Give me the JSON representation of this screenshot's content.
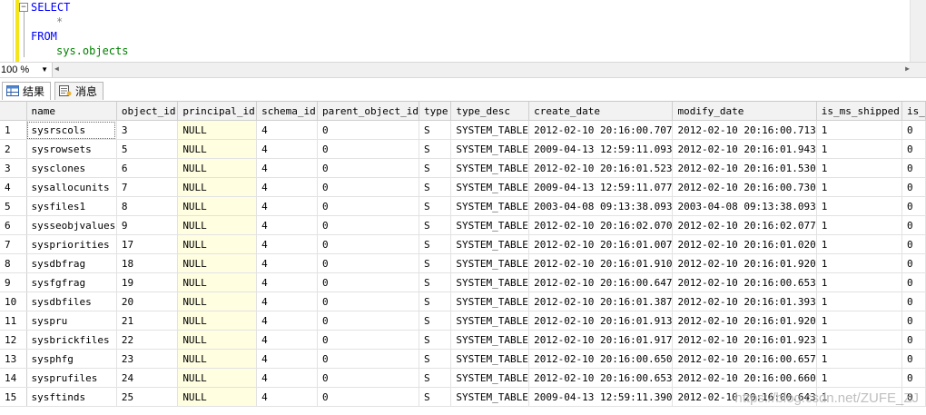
{
  "editor": {
    "lines": [
      "SELECT",
      "*",
      "FROM",
      "sys.objects"
    ],
    "fold_symbol": "−"
  },
  "zoom": {
    "value": "100 %"
  },
  "tabs": [
    {
      "label": "结果",
      "icon": "results-grid-icon"
    },
    {
      "label": "消息",
      "icon": "messages-icon"
    }
  ],
  "grid": {
    "columns": [
      "",
      "name",
      "object_id",
      "principal_id",
      "schema_id",
      "parent_object_id",
      "type",
      "type_desc",
      "create_date",
      "modify_date",
      "is_ms_shipped",
      "is_"
    ],
    "rows": [
      [
        "1",
        "sysrscols",
        "3",
        "NULL",
        "4",
        "0",
        "S",
        "SYSTEM_TABLE",
        "2012-02-10 20:16:00.707",
        "2012-02-10 20:16:00.713",
        "1",
        "0"
      ],
      [
        "2",
        "sysrowsets",
        "5",
        "NULL",
        "4",
        "0",
        "S",
        "SYSTEM_TABLE",
        "2009-04-13 12:59:11.093",
        "2012-02-10 20:16:01.943",
        "1",
        "0"
      ],
      [
        "3",
        "sysclones",
        "6",
        "NULL",
        "4",
        "0",
        "S",
        "SYSTEM_TABLE",
        "2012-02-10 20:16:01.523",
        "2012-02-10 20:16:01.530",
        "1",
        "0"
      ],
      [
        "4",
        "sysallocunits",
        "7",
        "NULL",
        "4",
        "0",
        "S",
        "SYSTEM_TABLE",
        "2009-04-13 12:59:11.077",
        "2012-02-10 20:16:00.730",
        "1",
        "0"
      ],
      [
        "5",
        "sysfiles1",
        "8",
        "NULL",
        "4",
        "0",
        "S",
        "SYSTEM_TABLE",
        "2003-04-08 09:13:38.093",
        "2003-04-08 09:13:38.093",
        "1",
        "0"
      ],
      [
        "6",
        "sysseobjvalues",
        "9",
        "NULL",
        "4",
        "0",
        "S",
        "SYSTEM_TABLE",
        "2012-02-10 20:16:02.070",
        "2012-02-10 20:16:02.077",
        "1",
        "0"
      ],
      [
        "7",
        "syspriorities",
        "17",
        "NULL",
        "4",
        "0",
        "S",
        "SYSTEM_TABLE",
        "2012-02-10 20:16:01.007",
        "2012-02-10 20:16:01.020",
        "1",
        "0"
      ],
      [
        "8",
        "sysdbfrag",
        "18",
        "NULL",
        "4",
        "0",
        "S",
        "SYSTEM_TABLE",
        "2012-02-10 20:16:01.910",
        "2012-02-10 20:16:01.920",
        "1",
        "0"
      ],
      [
        "9",
        "sysfgfrag",
        "19",
        "NULL",
        "4",
        "0",
        "S",
        "SYSTEM_TABLE",
        "2012-02-10 20:16:00.647",
        "2012-02-10 20:16:00.653",
        "1",
        "0"
      ],
      [
        "10",
        "sysdbfiles",
        "20",
        "NULL",
        "4",
        "0",
        "S",
        "SYSTEM_TABLE",
        "2012-02-10 20:16:01.387",
        "2012-02-10 20:16:01.393",
        "1",
        "0"
      ],
      [
        "11",
        "syspru",
        "21",
        "NULL",
        "4",
        "0",
        "S",
        "SYSTEM_TABLE",
        "2012-02-10 20:16:01.913",
        "2012-02-10 20:16:01.920",
        "1",
        "0"
      ],
      [
        "12",
        "sysbrickfiles",
        "22",
        "NULL",
        "4",
        "0",
        "S",
        "SYSTEM_TABLE",
        "2012-02-10 20:16:01.917",
        "2012-02-10 20:16:01.923",
        "1",
        "0"
      ],
      [
        "13",
        "sysphfg",
        "23",
        "NULL",
        "4",
        "0",
        "S",
        "SYSTEM_TABLE",
        "2012-02-10 20:16:00.650",
        "2012-02-10 20:16:00.657",
        "1",
        "0"
      ],
      [
        "14",
        "sysprufiles",
        "24",
        "NULL",
        "4",
        "0",
        "S",
        "SYSTEM_TABLE",
        "2012-02-10 20:16:00.653",
        "2012-02-10 20:16:00.660",
        "1",
        "0"
      ],
      [
        "15",
        "sysftinds",
        "25",
        "NULL",
        "4",
        "0",
        "S",
        "SYSTEM_TABLE",
        "2009-04-13 12:59:11.390",
        "2012-02-10 20:16:00.643",
        "1",
        "0"
      ]
    ]
  },
  "watermark": "https://blog.csdn.net/ZUFE_ZJ"
}
